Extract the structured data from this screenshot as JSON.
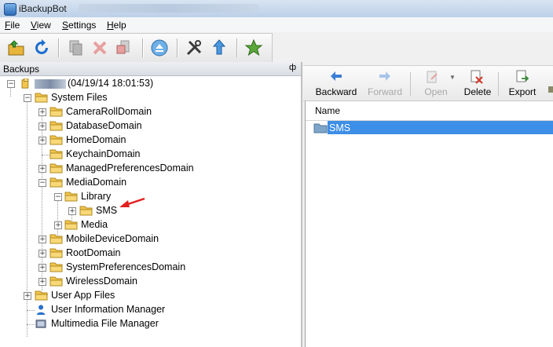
{
  "window": {
    "title": "iBackupBot"
  },
  "menu": [
    {
      "key": "F",
      "rest": "ile"
    },
    {
      "key": "V",
      "rest": "iew"
    },
    {
      "key": "S",
      "rest": "ettings"
    },
    {
      "key": "H",
      "rest": "elp"
    }
  ],
  "toolbar": {
    "icons": [
      "open-backup-icon",
      "refresh-icon",
      "copy-icon",
      "delete-icon",
      "restore-icon",
      "eject-icon",
      "tools-icon",
      "upload-icon",
      "favorite-star-icon"
    ]
  },
  "left_panel": {
    "header": "Backups",
    "pin_glyph": "ф",
    "backup_label": "(04/19/14 18:01:53)",
    "system_files": "System Files",
    "domains": [
      "CameraRollDomain",
      "DatabaseDomain",
      "HomeDomain",
      "KeychainDomain",
      "ManagedPreferencesDomain",
      "MediaDomain"
    ],
    "library": "Library",
    "sms": "SMS",
    "media": "Media",
    "domains_after": [
      "MobileDeviceDomain",
      "RootDomain",
      "SystemPreferencesDomain",
      "WirelessDomain"
    ],
    "user_app_files": "User App Files",
    "user_info_manager": "User Information Manager",
    "multimedia_manager": "Multimedia File Manager"
  },
  "right_panel": {
    "buttons": {
      "backward": "Backward",
      "forward": "Forward",
      "open": "Open",
      "delete": "Delete",
      "export": "Export"
    },
    "column_name": "Name",
    "items": [
      "SMS"
    ]
  },
  "colors": {
    "selection": "#3d8ee6",
    "folder": "#f3c54e",
    "arrow": "#e02020"
  }
}
